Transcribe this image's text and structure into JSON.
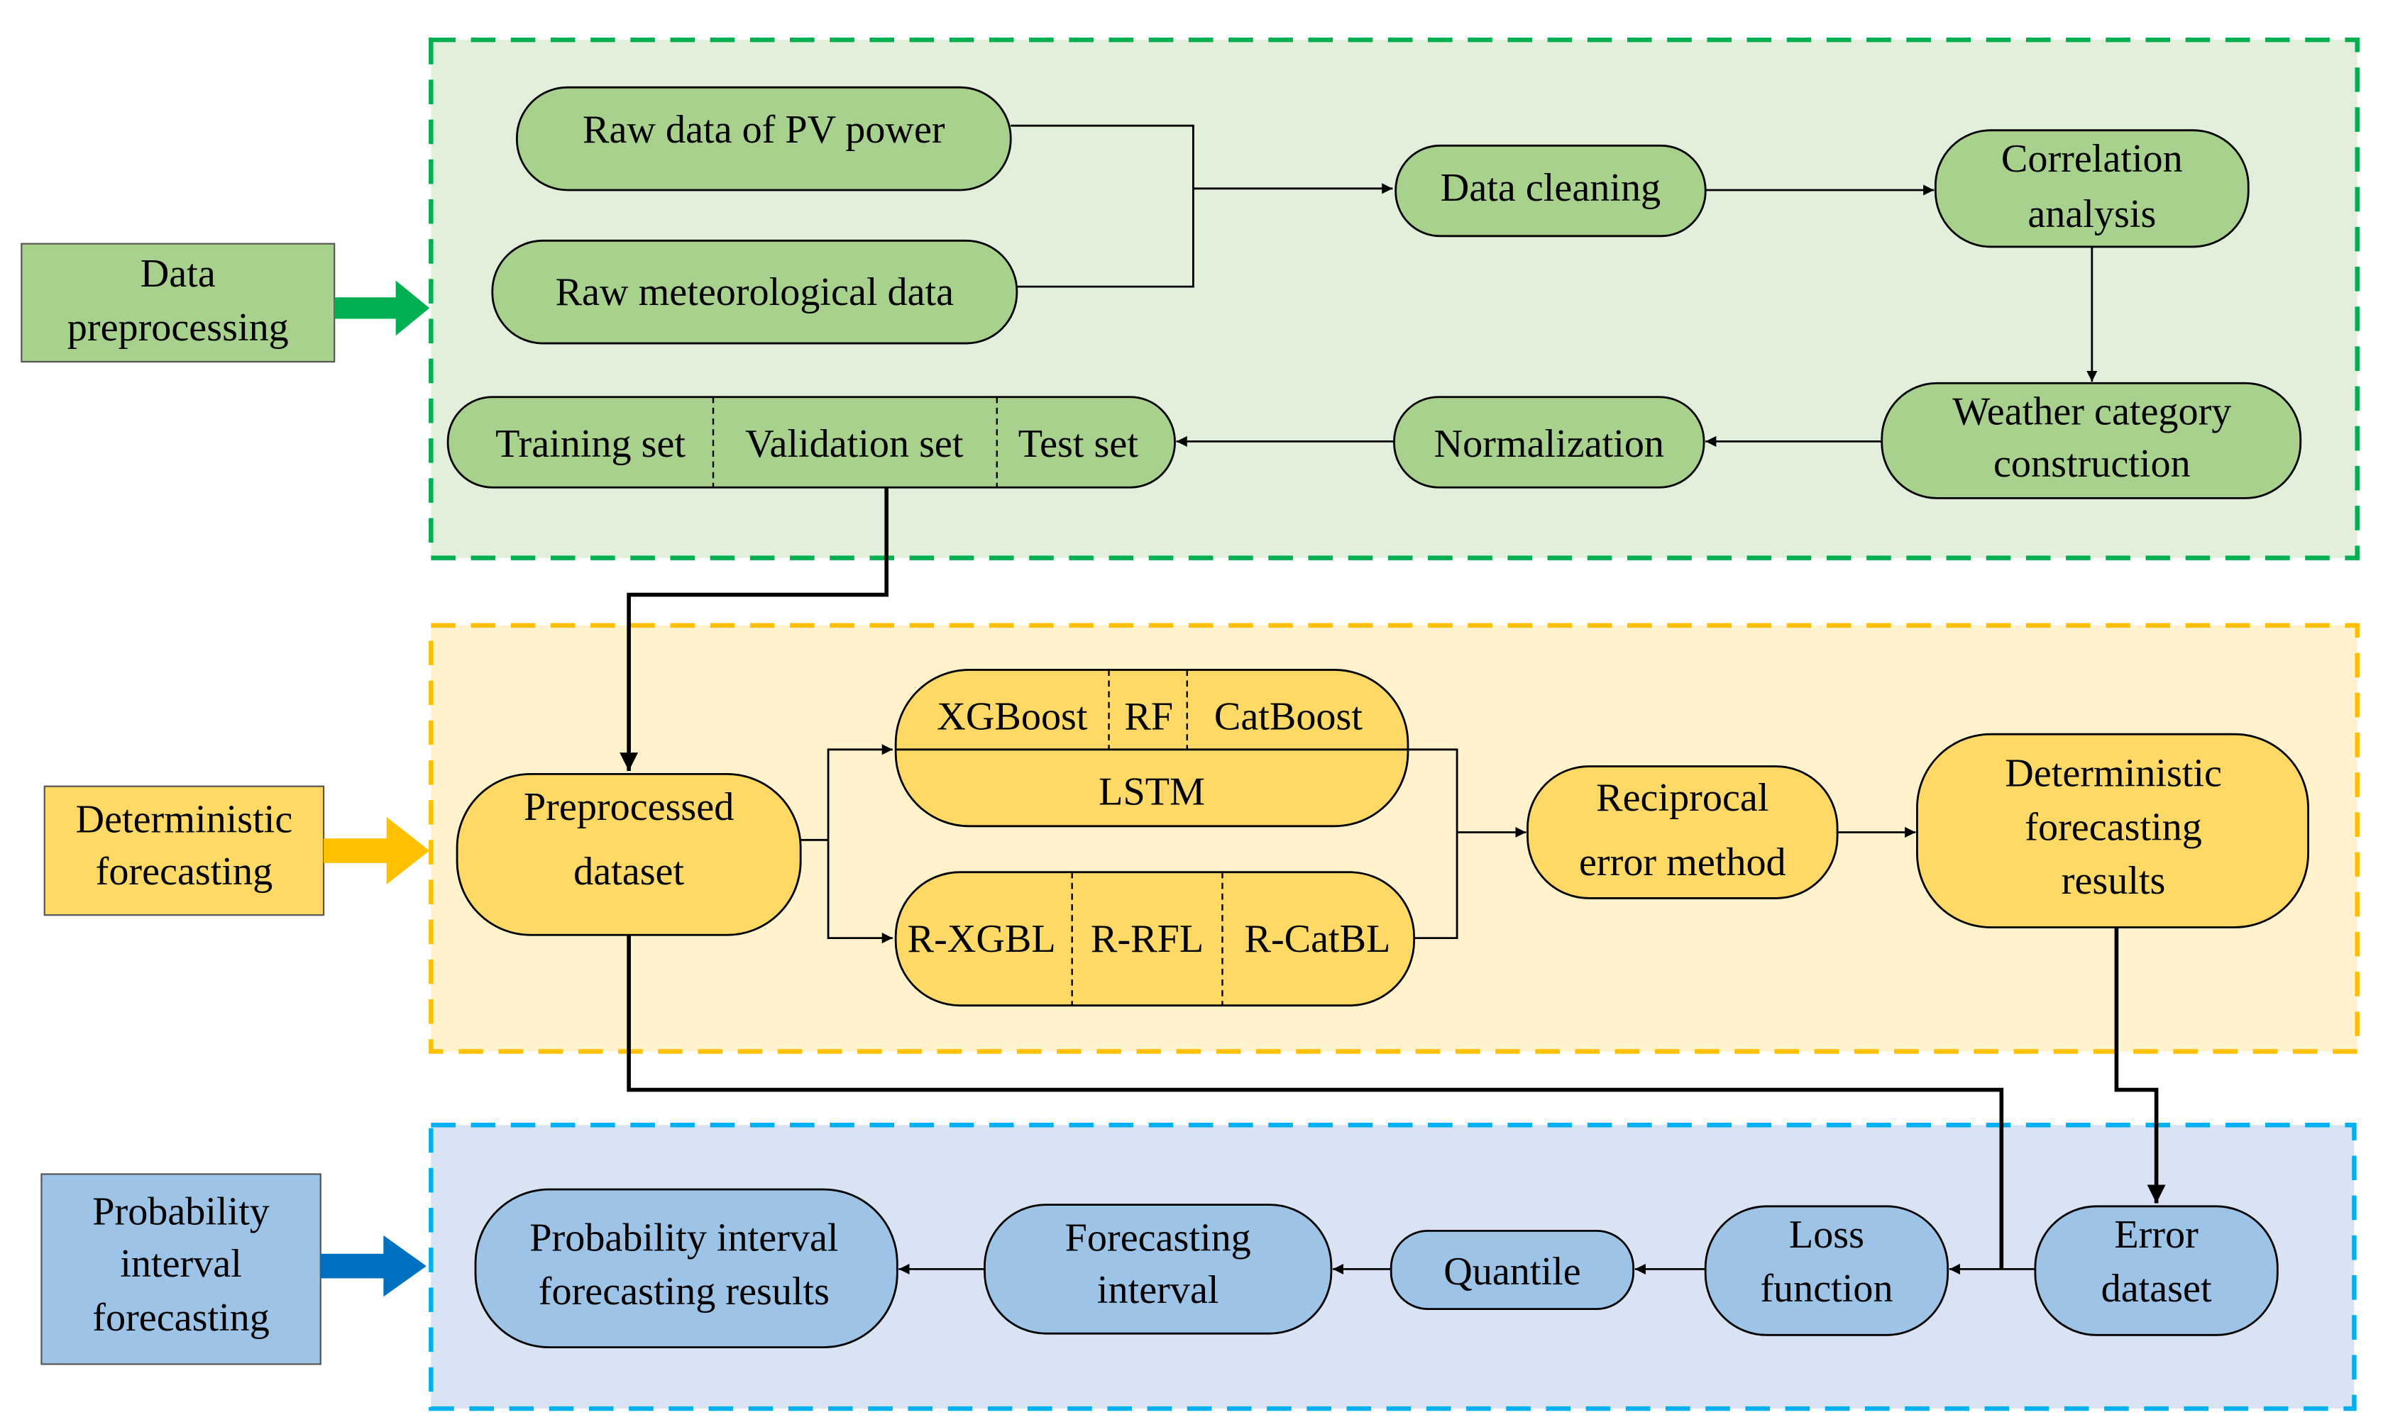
{
  "colors": {
    "green_fill": "#a9d18e",
    "green_panel": "#e2efda",
    "green_border": "#00b050",
    "yellow_fill": "#ffd966",
    "yellow_panel": "#fff2cc",
    "yellow_border": "#ffc000",
    "blue_fill": "#9dc3e6",
    "blue_panel": "#dae3f3",
    "blue_border": "#00b0f0",
    "blue_arrow": "#0070c0"
  },
  "stages": {
    "preprocessing": {
      "label_lines": [
        "Data",
        "preprocessing"
      ]
    },
    "deterministic": {
      "label_lines": [
        "Deterministic",
        "forecasting"
      ]
    },
    "probability": {
      "label_lines": [
        "Probability",
        "interval",
        "forecasting"
      ]
    }
  },
  "nodes": {
    "raw_pv": "Raw data of PV power",
    "raw_met": "Raw meteorological data",
    "data_cleaning": "Data cleaning",
    "correlation": [
      "Correlation",
      "analysis"
    ],
    "weather_category": [
      "Weather category",
      "construction"
    ],
    "normalization": "Normalization",
    "dataset_split": [
      "Training set",
      "Validation set",
      "Test set"
    ],
    "preprocessed": [
      "Preprocessed",
      "dataset"
    ],
    "base_models_top": [
      "XGBoost",
      "RF",
      "CatBoost"
    ],
    "base_models_bottom": "LSTM",
    "hybrid_models": [
      "R-XGBL",
      "R-RFL",
      "R-CatBL"
    ],
    "reciprocal": [
      "Reciprocal",
      "error method"
    ],
    "det_results": [
      "Deterministic",
      "forecasting",
      "results"
    ],
    "error_dataset": [
      "Error",
      "dataset"
    ],
    "loss_function": [
      "Loss",
      "function"
    ],
    "quantile": "Quantile",
    "forecasting_interval": [
      "Forecasting",
      "interval"
    ],
    "prob_results": [
      "Probability interval",
      "forecasting results"
    ]
  }
}
